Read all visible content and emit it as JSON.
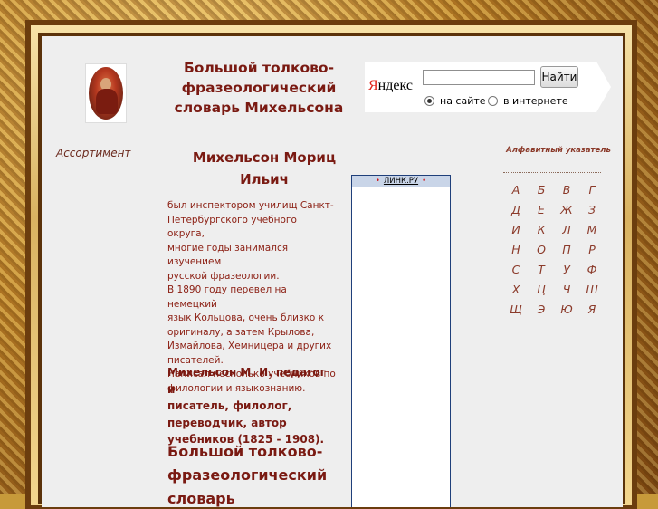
{
  "header": {
    "title": "Большой толково-фразеологический словарь Михельсона",
    "title_lines": [
      "Большой толково-",
      "фразеологический",
      "словарь Михельсона"
    ]
  },
  "search": {
    "logo": "Яндекс",
    "logo_first": "Я",
    "logo_rest": "ндекс",
    "input_value": "",
    "button_label": "Найти",
    "option_site": "на сайте",
    "option_web": "в интернете",
    "selected": "на сайте"
  },
  "nav": {
    "assortiment": "Ассортимент"
  },
  "article": {
    "name_lines": [
      "Михельсон Мориц",
      "Ильич"
    ],
    "bio_lines": [
      "был инспектором училищ Санкт-",
      "Петербургского учебного округа,",
      "многие годы занимался изучением",
      "русской фразеологии.",
      "В 1890 году перевел на немецкий",
      "язык Кольцова, очень близко к",
      "оригиналу, а затем Крылова,",
      "Измайлова, Хемницера и других",
      "писателей.",
      "Написал несколько учебников по",
      "филологии и языкознанию."
    ],
    "summary_lines": [
      "Михельсон М. И. педагог и",
      "писатель, филолог,",
      "переводчик, автор",
      "учебников (1825 - 1908)."
    ],
    "big_title_lines": [
      "Большой толково-",
      "фразеологический",
      "словарь Михельсона"
    ]
  },
  "ad": {
    "badge": "ЛИНК.РУ",
    "bullet": "•"
  },
  "index": {
    "title": "Алфавитный указатель",
    "letters": [
      "А",
      "Б",
      "В",
      "Г",
      "Д",
      "Е",
      "Ж",
      "З",
      "И",
      "К",
      "Л",
      "М",
      "Н",
      "О",
      "П",
      "Р",
      "С",
      "Т",
      "У",
      "Ф",
      "Х",
      "Ц",
      "Ч",
      "Ш",
      "Щ",
      "Э",
      "Ю",
      "Я"
    ]
  },
  "colors": {
    "accent": "#7a1a12",
    "page_bg": "#eeeeee",
    "frame_gold": "#c79a3a"
  }
}
